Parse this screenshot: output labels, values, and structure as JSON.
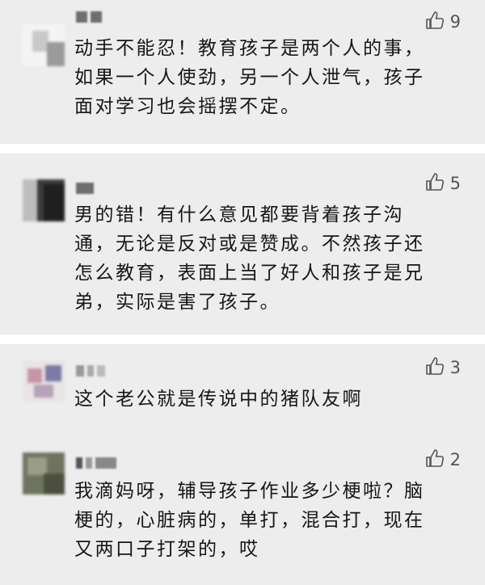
{
  "comments": [
    {
      "text": "动手不能忍！教育孩子是两个人的事，\n如果一个人使劲，另一个人泄气，孩子\n面对学习也会摇摆不定。",
      "likes": "9",
      "like_icon": "thumbs-up-icon"
    },
    {
      "text": "男的错！有什么意见都要背着孩子沟\n通，无论是反对或是赞成。不然孩子还\n怎么教育，表面上当了好人和孩子是兄\n弟，实际是害了孩子。",
      "likes": "5",
      "like_icon": "thumbs-up-icon"
    },
    {
      "text": "这个老公就是传说中的猪队友啊",
      "likes": "3",
      "like_icon": "thumbs-up-icon"
    },
    {
      "text": "我滴妈呀，辅导孩子作业多少梗啦？脑\n梗的，心脏病的，单打，混合打，现在\n又两口子打架的，哎",
      "likes": "2",
      "like_icon": "thumbs-up-icon"
    }
  ],
  "colors": {
    "background": "#ededed",
    "divider": "#ffffff",
    "text": "#161616",
    "like": "#555555"
  }
}
